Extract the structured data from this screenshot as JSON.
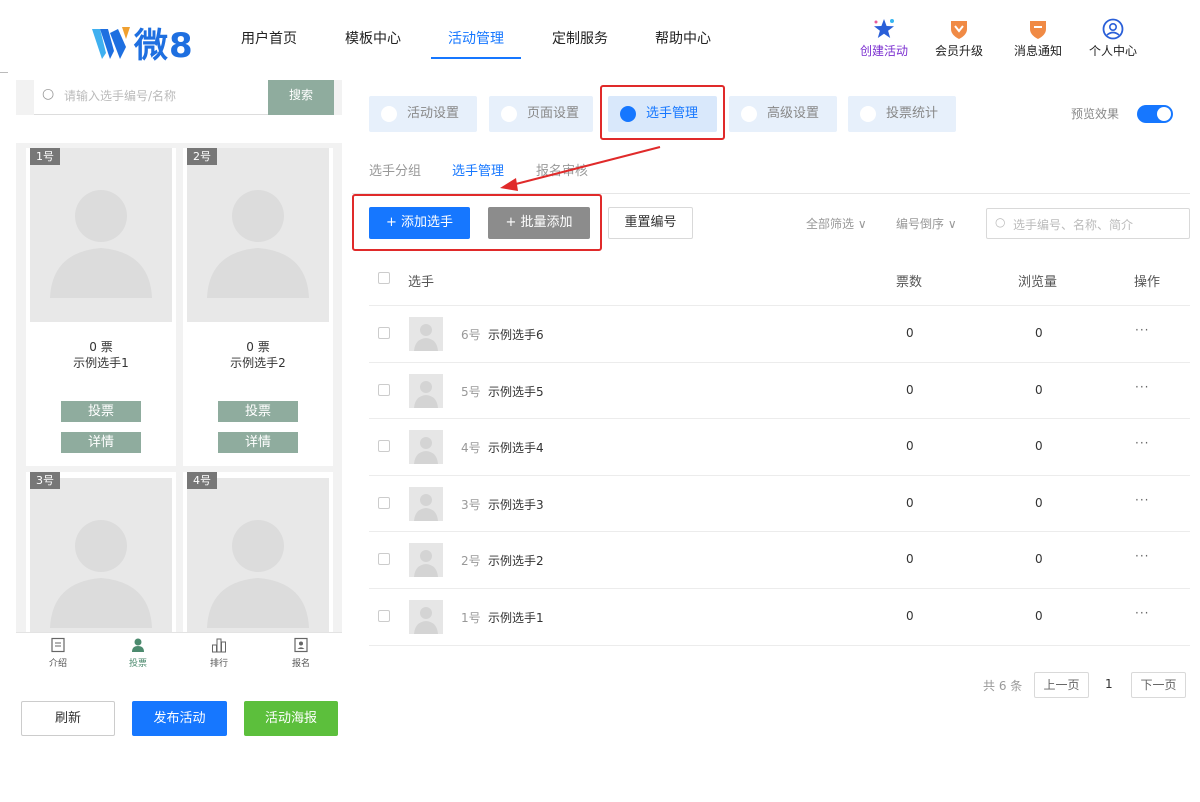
{
  "header": {
    "logo_text": "微8",
    "nav": [
      {
        "label": "用户首页",
        "active": false
      },
      {
        "label": "模板中心",
        "active": false
      },
      {
        "label": "活动管理",
        "active": true
      },
      {
        "label": "定制服务",
        "active": false
      },
      {
        "label": "帮助中心",
        "active": false
      }
    ],
    "quick_links": [
      {
        "label": "创建活动",
        "icon": "star-icon"
      },
      {
        "label": "会员升级",
        "icon": "vip-badge-icon"
      },
      {
        "label": "消息通知",
        "icon": "notification-badge-icon"
      },
      {
        "label": "个人中心",
        "icon": "user-circle-icon"
      }
    ]
  },
  "preview": {
    "search_placeholder": "请输入选手编号/名称",
    "search_button": "搜索",
    "cards": [
      {
        "num": "1号",
        "votes": "0 票",
        "name": "示例选手1",
        "vote_btn": "投票",
        "detail_btn": "详情"
      },
      {
        "num": "2号",
        "votes": "0 票",
        "name": "示例选手2",
        "vote_btn": "投票",
        "detail_btn": "详情"
      },
      {
        "num": "3号"
      },
      {
        "num": "4号"
      }
    ],
    "bottom_nav": [
      {
        "label": "介绍",
        "icon": "intro-icon",
        "active": false
      },
      {
        "label": "投票",
        "icon": "vote-person-icon",
        "active": true
      },
      {
        "label": "排行",
        "icon": "ranking-icon",
        "active": false
      },
      {
        "label": "报名",
        "icon": "signup-icon",
        "active": false
      }
    ]
  },
  "actions": {
    "refresh": "刷新",
    "publish": "发布活动",
    "poster": "活动海报"
  },
  "panel_tabs": [
    {
      "label": "活动设置",
      "icon": "heart-icon",
      "active": false
    },
    {
      "label": "页面设置",
      "icon": "page-icon",
      "active": false
    },
    {
      "label": "选手管理",
      "icon": "user-icon",
      "active": true
    },
    {
      "label": "高级设置",
      "icon": "percent-icon",
      "active": false
    },
    {
      "label": "投票统计",
      "icon": "stats-icon",
      "active": false
    }
  ],
  "preview_toggle": {
    "label": "预览效果",
    "on": true
  },
  "sub_tabs": [
    {
      "label": "选手分组",
      "active": false
    },
    {
      "label": "选手管理",
      "active": true
    },
    {
      "label": "报名审核",
      "active": false
    }
  ],
  "toolbar": {
    "add": "+ 添加选手",
    "batch_add": "+ 批量添加",
    "renumber": "重置编号",
    "filter_all": "全部筛选 ∨",
    "sort": "编号倒序 ∨",
    "search_placeholder": "选手编号、名称、简介"
  },
  "table": {
    "headers": {
      "player": "选手",
      "votes": "票数",
      "views": "浏览量",
      "ops": "操作"
    },
    "rows": [
      {
        "num": "6号",
        "name": "示例选手6",
        "votes": "0",
        "views": "0",
        "ops": "···"
      },
      {
        "num": "5号",
        "name": "示例选手5",
        "votes": "0",
        "views": "0",
        "ops": "···"
      },
      {
        "num": "4号",
        "name": "示例选手4",
        "votes": "0",
        "views": "0",
        "ops": "···"
      },
      {
        "num": "3号",
        "name": "示例选手3",
        "votes": "0",
        "views": "0",
        "ops": "···"
      },
      {
        "num": "2号",
        "name": "示例选手2",
        "votes": "0",
        "views": "0",
        "ops": "···"
      },
      {
        "num": "1号",
        "name": "示例选手1",
        "votes": "0",
        "views": "0",
        "ops": "···"
      }
    ]
  },
  "pagination": {
    "total": "共 6 条",
    "prev": "上一页",
    "current": "1",
    "next": "下一页"
  },
  "colors": {
    "primary": "#1677ff",
    "highlight": "#e02a2a",
    "vote_green": "#8fac9e",
    "poster_green": "#5cbf3c"
  }
}
